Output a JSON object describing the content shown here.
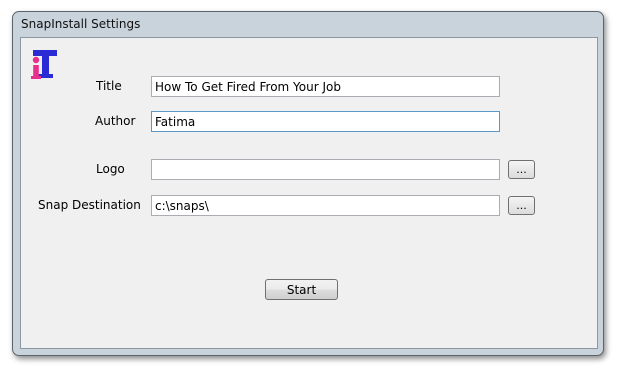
{
  "window": {
    "title": "SnapInstall Settings"
  },
  "form": {
    "title_label": "Title",
    "title_value": "How To Get Fired From Your Job",
    "author_label": "Author",
    "author_value": "Fatima",
    "logo_label": "Logo",
    "logo_value": "",
    "logo_browse_label": "...",
    "snap_destination_label": "Snap Destination",
    "snap_destination_value": "c:\\snaps\\",
    "snap_destination_browse_label": "..."
  },
  "actions": {
    "start_label": "Start"
  },
  "icons": {
    "app_logo": "app-logo-icon"
  }
}
